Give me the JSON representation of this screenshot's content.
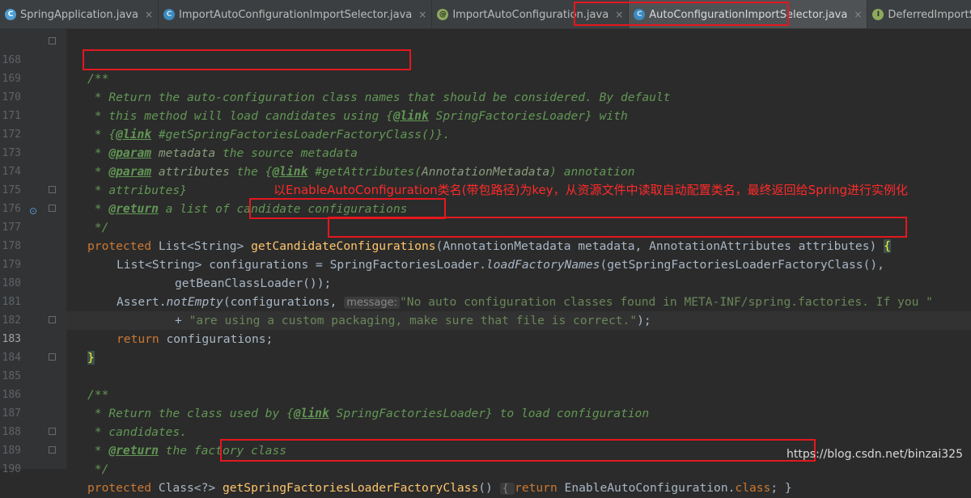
{
  "tabs": [
    {
      "icon": "C",
      "label": "SpringApplication.java"
    },
    {
      "icon": "C",
      "label": "ImportAutoConfigurationImportSelector.java"
    },
    {
      "icon": "@",
      "label": "ImportAutoConfiguration.java"
    },
    {
      "icon": "C",
      "label": "AutoConfigurationImportSelector.java",
      "active": true
    },
    {
      "icon": "I",
      "label": "DeferredImportSelector.java"
    }
  ],
  "close_glyph": "×",
  "annotation": "以EnableAutoConfiguration类名(带包路径)为key，从资源文件中读取自动配置类名，最终返回给Spring进行实例化",
  "watermark": "https://blog.csdn.net/binzai325",
  "lines": [
    {
      "n": "168"
    },
    {
      "n": "169"
    },
    {
      "n": "170"
    },
    {
      "n": "171"
    },
    {
      "n": "172"
    },
    {
      "n": "173"
    },
    {
      "n": "174"
    },
    {
      "n": "175"
    },
    {
      "n": "176"
    },
    {
      "n": "177"
    },
    {
      "n": "178"
    },
    {
      "n": "179"
    },
    {
      "n": "180"
    },
    {
      "n": "181"
    },
    {
      "n": "182"
    },
    {
      "n": "183"
    },
    {
      "n": "184"
    },
    {
      "n": "185"
    },
    {
      "n": "186"
    },
    {
      "n": "187"
    },
    {
      "n": "188"
    },
    {
      "n": "189"
    },
    {
      "n": "190"
    }
  ],
  "code": {
    "l168": "/**",
    "l169_a": " * ",
    "l169_b": "Return the auto-configuration class names",
    "l169_c": " that should be considered. By default",
    "l170_a": " * this method will load candidates using {",
    "l170_tag": "@link",
    "l170_b": " SpringFactoriesLoader} with",
    "l171_a": " * {",
    "l171_tag": "@link",
    "l171_b": " #getSpringFactoriesLoaderFactoryClass()}.",
    "l172_a": " * ",
    "l172_tag": "@param",
    "l172_b": " metadata",
    "l172_c": " the source metadata",
    "l173_a": " * ",
    "l173_tag": "@param",
    "l173_b": " attributes",
    "l173_c": " the {",
    "l173_tag2": "@link",
    "l173_d": " #getAttributes(",
    "l173_e": "AnnotationMetadata",
    "l173_f": ") annotation",
    "l174": " * attributes}",
    "l175_a": " * ",
    "l175_tag": "@return",
    "l175_b": " a list of candidate configurations",
    "l176": " */",
    "l177_kw": "protected",
    "l177_a": " List<String> ",
    "l177_fn": "getCandidateConfigurations",
    "l177_b": "(AnnotationMetadata metadata, AnnotationAttributes attributes) ",
    "l177_brace": "{",
    "l178_a": "List<String> configurations = ",
    "l178_b": "SpringFactoriesLoader.",
    "l178_it": "loadFactoryNames",
    "l178_c": "(getSpringFactoriesLoaderFactoryClass(),",
    "l179": "getBeanClassLoader());",
    "l180_a": "Assert.",
    "l180_it": "notEmpty",
    "l180_b": "(configurations, ",
    "l180_hint": "message:",
    "l180_str": "\"No auto configuration classes found in META-INF/spring.factories. If you \"",
    "l181_a": "+ ",
    "l181_str": "\"are using a custom packaging, make sure that file is correct.\"",
    "l181_b": ");",
    "l182_kw": "return",
    "l182_a": " configurations;",
    "l183": "}",
    "l185": "/**",
    "l186_a": " * Return the class used by {",
    "l186_tag": "@link",
    "l186_b": " SpringFactoriesLoader} to load configuration",
    "l187": " * candidates.",
    "l188_a": " * ",
    "l188_tag": "@return",
    "l188_b": " the factory class",
    "l189": " */",
    "l190_kw": "protected",
    "l190_a": " Class<?> ",
    "l190_fn": "getSpringFactoriesLoaderFactoryClass",
    "l190_b": "() ",
    "l190_c": "{ ",
    "l190_kw2": "return",
    "l190_d": " EnableAutoConfiguration.",
    "l190_kw3": "class",
    "l190_e": "; }"
  }
}
